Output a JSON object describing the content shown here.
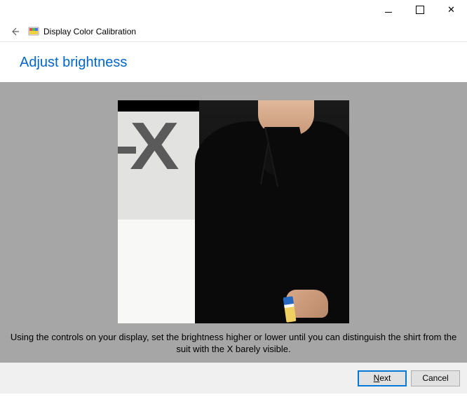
{
  "window": {
    "app_title": "Display Color Calibration"
  },
  "page": {
    "heading": "Adjust brightness",
    "instruction": "Using the controls on your display, set the brightness higher or lower until you can distinguish the shirt from the suit with the X barely visible."
  },
  "buttons": {
    "next": "Next",
    "cancel": "Cancel"
  }
}
